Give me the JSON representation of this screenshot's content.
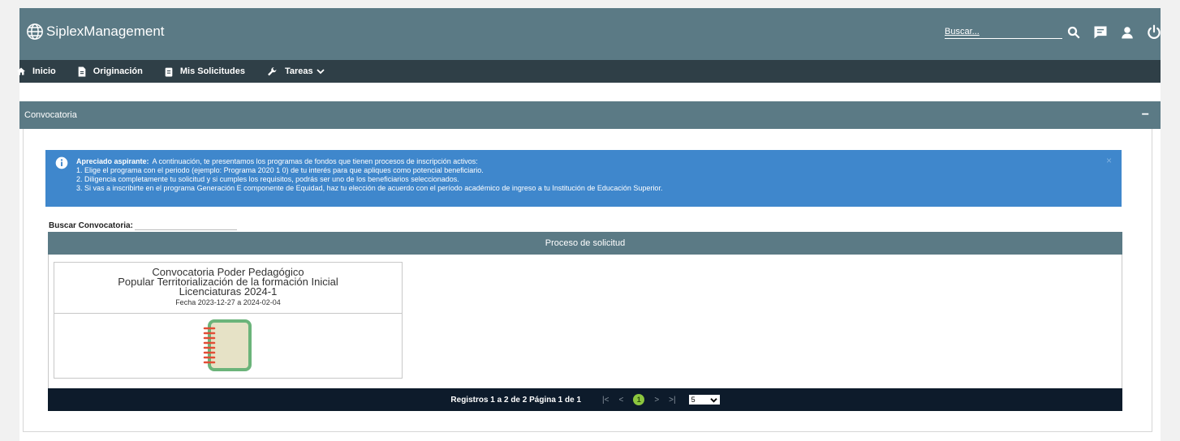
{
  "header": {
    "brand": "SiplexManagement",
    "search_placeholder": "Buscar..."
  },
  "nav": {
    "items": [
      {
        "label": "Inicio",
        "icon": "home-icon"
      },
      {
        "label": "Originación",
        "icon": "document-icon"
      },
      {
        "label": "Mis Solicitudes",
        "icon": "clipboard-icon"
      },
      {
        "label": "Tareas",
        "icon": "wrench-icon"
      }
    ]
  },
  "panel": {
    "title": "Convocatoria",
    "collapse": "−"
  },
  "alert": {
    "title": "Apreciado aspirante:",
    "intro": "A continuación, te presentamos los programas de fondos que tienen procesos de inscripción activos:",
    "lines": [
      "1. Elige el programa con el periodo (ejemplo: Programa 2020 1 0) de tu interés para que apliques como potencial beneficiario.",
      "2. Diligencia completamente tu solicitud y si cumples los requisitos, podrás ser uno de los beneficiarios seleccionados.",
      "3. Si vas a inscribirte en el programa Generación E componente de Equidad, haz tu elección de acuerdo con el período académico de ingreso a tu Institución de Educación Superior."
    ],
    "close": "×"
  },
  "search_conv": {
    "label": "Buscar Convocatoria:"
  },
  "proceso": {
    "header": "Proceso de solicitud",
    "cards": [
      {
        "title_lines": [
          "Convocatoria Poder Pedagógico",
          "Popular Territorialización de la formación Inicial",
          "Licenciaturas 2024-1"
        ],
        "date": "Fecha 2023-12-27 a 2024-02-04",
        "icon": "notebook-icon"
      }
    ]
  },
  "pager": {
    "summary": "Registros 1 a 2 de 2  Página 1 de 1",
    "first": "|<",
    "prev": "<",
    "current": "1",
    "next": ">",
    "last": ">|",
    "page_size": "5"
  },
  "colors": {
    "header": "#5b7a85",
    "nav": "#2f3f47",
    "alert": "#3f87cc",
    "pager": "#0d1b2b",
    "active_page": "#8cc63f"
  }
}
